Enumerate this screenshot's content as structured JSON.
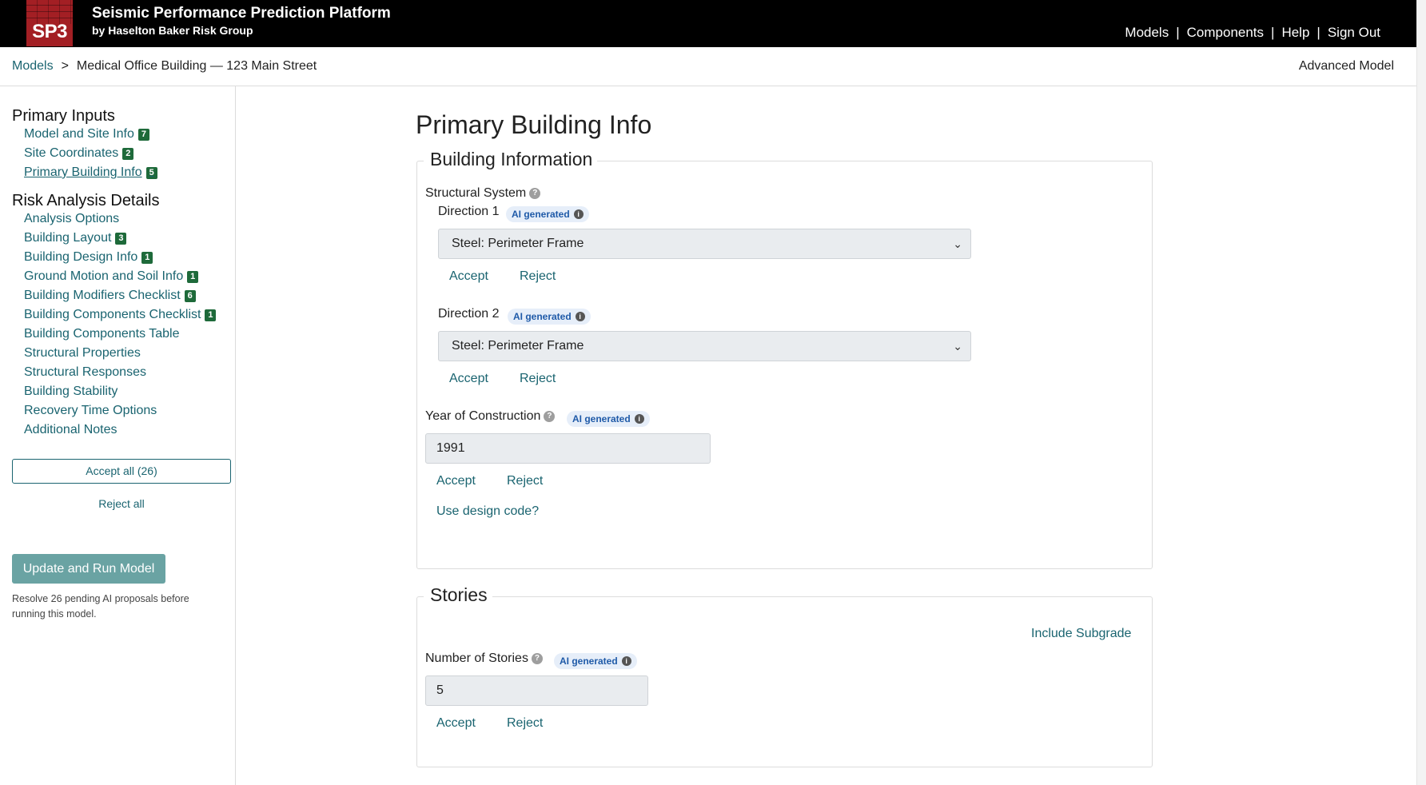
{
  "header": {
    "logo_text": "SP3",
    "title": "Seismic Performance Prediction Platform",
    "subtitle": "by Haselton Baker Risk Group",
    "nav": [
      "Models",
      "Components",
      "Help",
      "Sign Out"
    ],
    "nav_separator": "|"
  },
  "breadcrumb": {
    "root": "Models",
    "separator": ">",
    "current": "Medical Office Building — 123 Main Street",
    "mode": "Advanced Model"
  },
  "sidebar": {
    "section1_title": "Primary Inputs",
    "section1_items": [
      {
        "label": "Model and Site Info",
        "count": "7"
      },
      {
        "label": "Site Coordinates",
        "count": "2"
      },
      {
        "label": "Primary Building Info",
        "count": "5"
      }
    ],
    "section2_title": "Risk Analysis Details",
    "section2_items": [
      {
        "label": "Analysis Options",
        "count": ""
      },
      {
        "label": "Building Layout",
        "count": "3"
      },
      {
        "label": "Building Design Info",
        "count": "1"
      },
      {
        "label": "Ground Motion and Soil Info",
        "count": "1"
      },
      {
        "label": "Building Modifiers Checklist",
        "count": "6"
      },
      {
        "label": "Building Components Checklist",
        "count": "1"
      },
      {
        "label": "Building Components Table",
        "count": ""
      },
      {
        "label": "Structural Properties",
        "count": ""
      },
      {
        "label": "Structural Responses",
        "count": ""
      },
      {
        "label": "Building Stability",
        "count": ""
      },
      {
        "label": "Recovery Time Options",
        "count": ""
      },
      {
        "label": "Additional Notes",
        "count": ""
      }
    ],
    "accept_all": "Accept all (26)",
    "reject_all": "Reject all",
    "run_button": "Update and Run Model",
    "run_note": "Resolve 26 pending AI proposals before running this model."
  },
  "main": {
    "title": "Primary Building Info",
    "building_info": {
      "legend": "Building Information",
      "structural_system_label": "Structural System",
      "direction1_label": "Direction 1",
      "direction1_value": "Steel: Perimeter Frame",
      "direction2_label": "Direction 2",
      "direction2_value": "Steel: Perimeter Frame",
      "year_label": "Year of Construction",
      "year_value": "1991",
      "use_design_code": "Use design code?"
    },
    "stories": {
      "legend": "Stories",
      "include_subgrade": "Include Subgrade",
      "number_label": "Number of Stories",
      "number_value": "5"
    },
    "ai_badge": "AI generated",
    "accept": "Accept",
    "reject": "Reject",
    "help_glyph": "?",
    "info_glyph": "i"
  }
}
